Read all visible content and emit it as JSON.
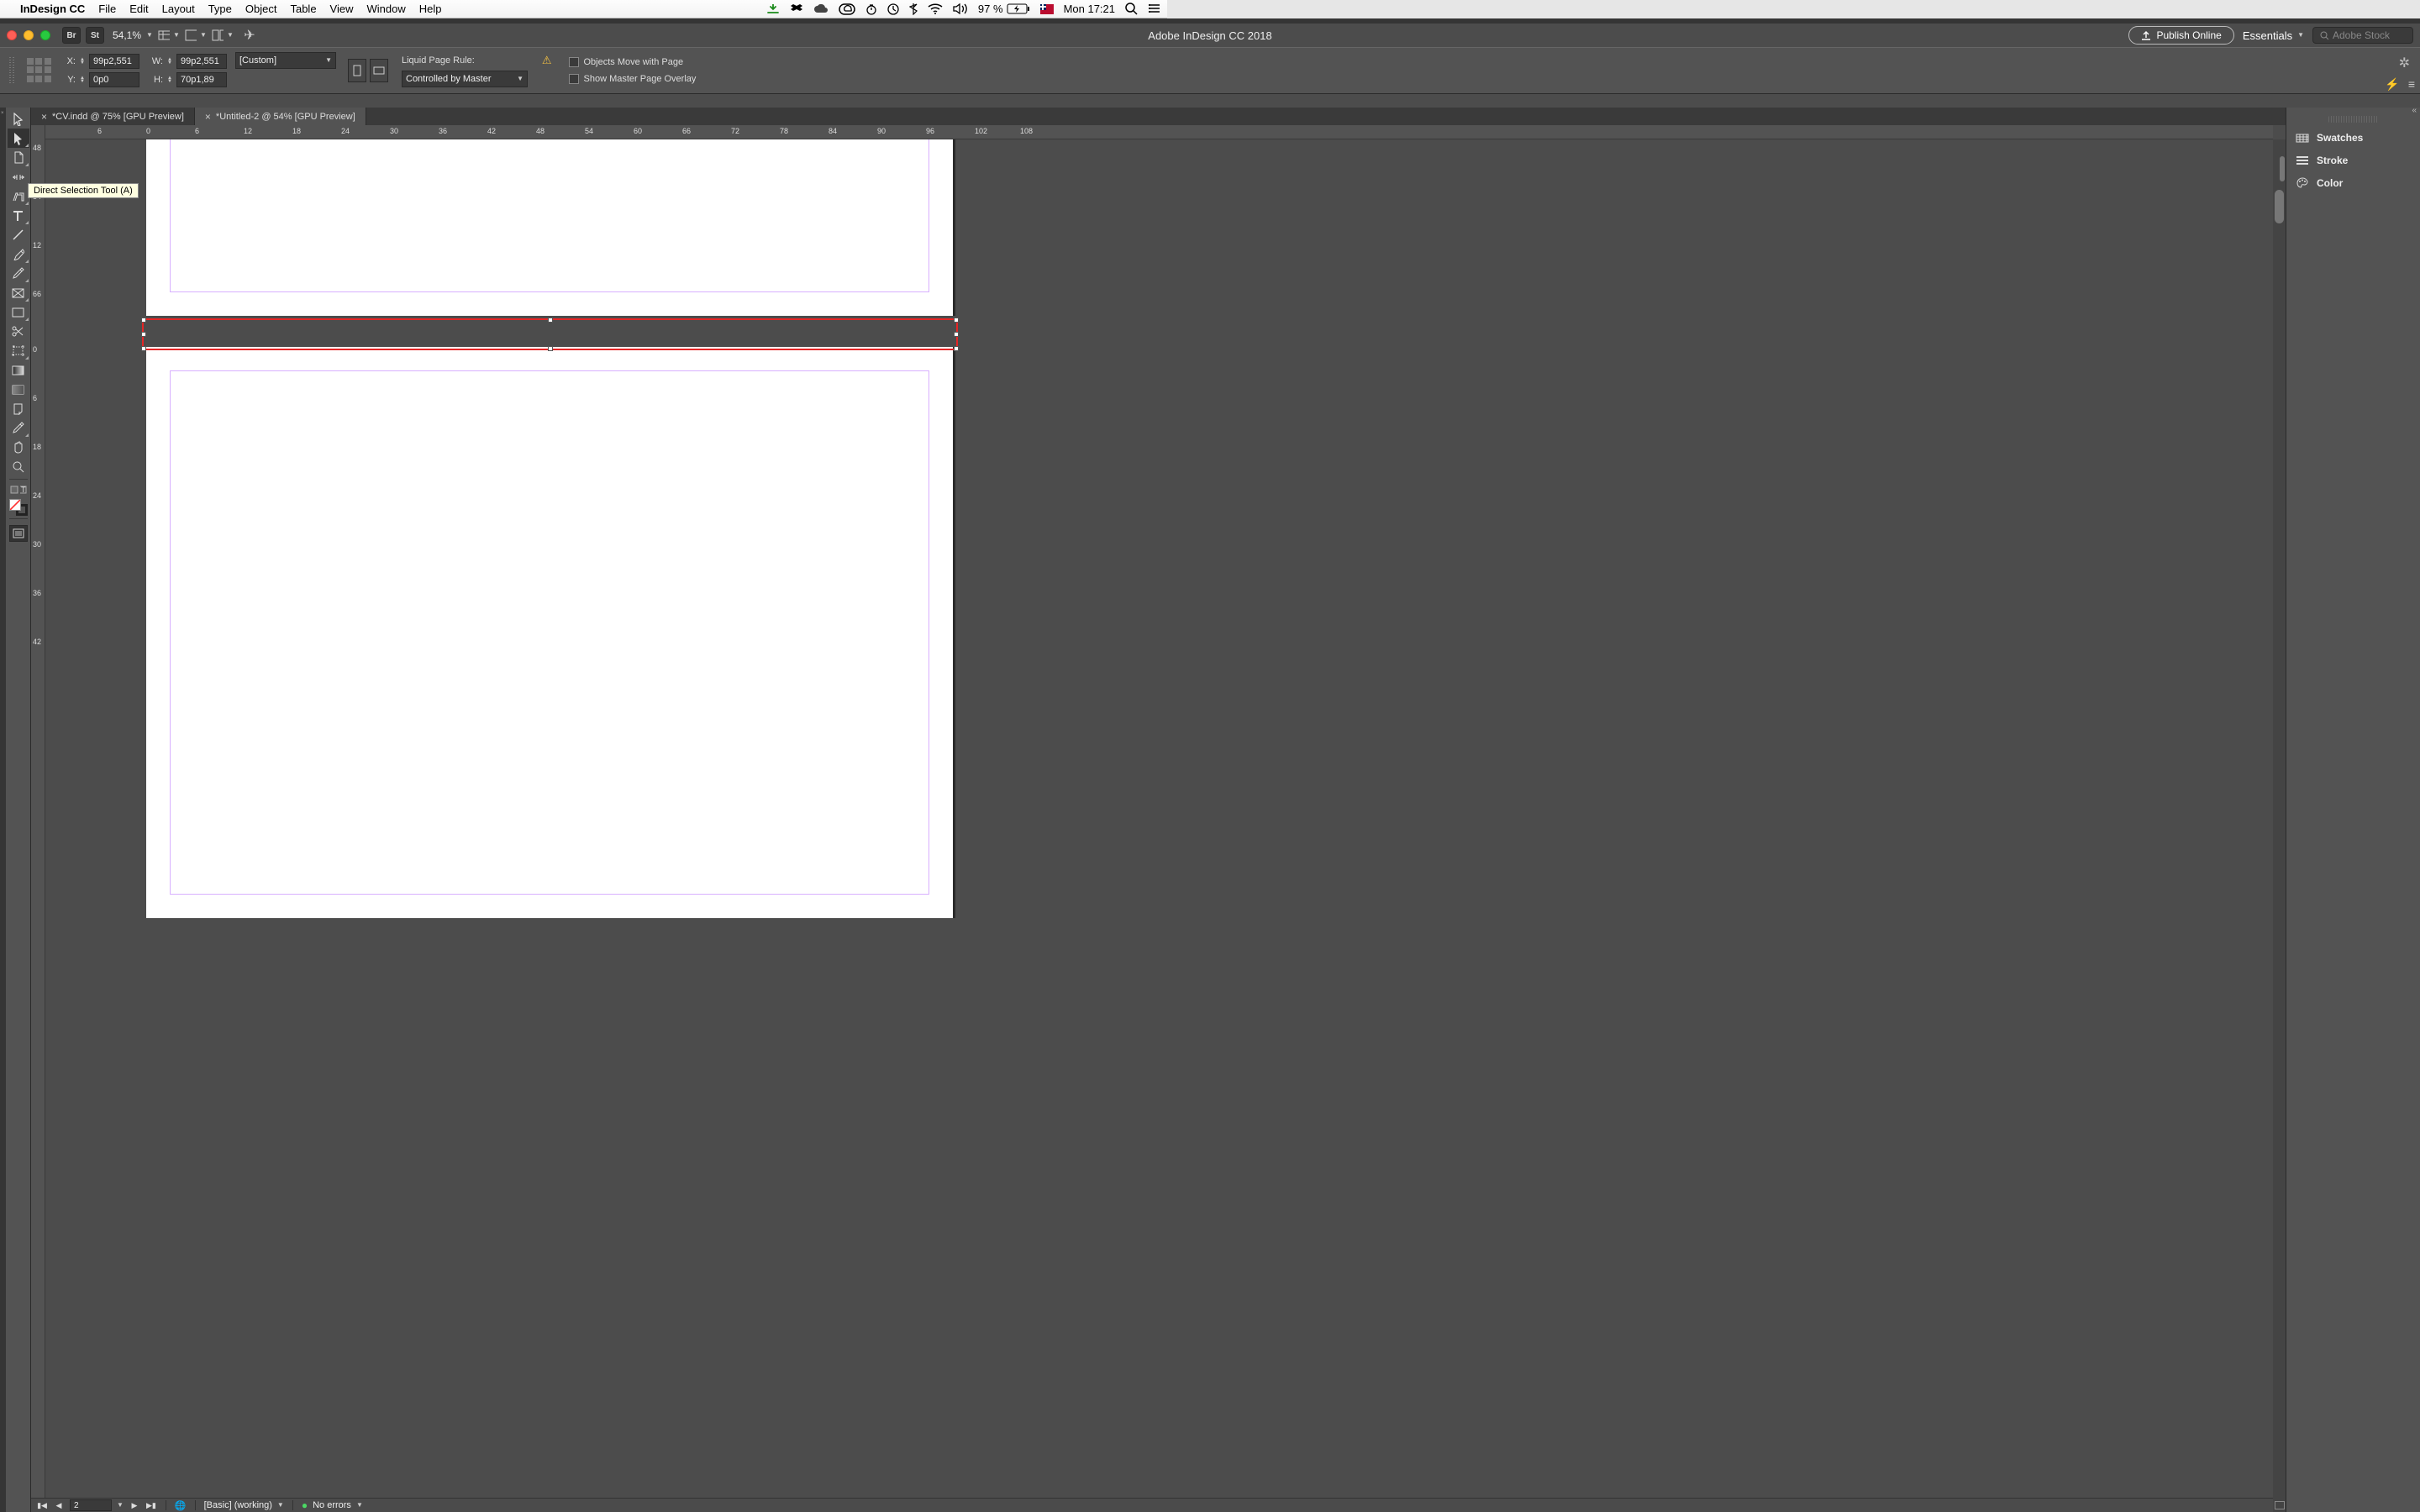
{
  "menubar": {
    "app_name": "InDesign CC",
    "items": [
      "File",
      "Edit",
      "Layout",
      "Type",
      "Object",
      "Table",
      "View",
      "Window",
      "Help"
    ],
    "battery": "97 %",
    "clock": "Mon 17:21"
  },
  "titlebar": {
    "br": "Br",
    "st": "St",
    "zoom": "54,1%",
    "title": "Adobe InDesign CC 2018",
    "publish": "Publish Online",
    "workspace": "Essentials",
    "search_placeholder": "Adobe Stock"
  },
  "controlbar": {
    "x_label": "X:",
    "y_label": "Y:",
    "w_label": "W:",
    "h_label": "H:",
    "x": "99p2,551",
    "y": "0p0",
    "w": "99p2,551",
    "h": "70p1,89",
    "preset": "[Custom]",
    "liquid_label": "Liquid Page Rule:",
    "liquid_value": "Controlled by Master",
    "cb1": "Objects Move with Page",
    "cb2": "Show Master Page Overlay"
  },
  "tooltip": "Direct Selection Tool (A)",
  "tabs": [
    {
      "label": "*CV.indd @ 75% [GPU Preview]",
      "active": false
    },
    {
      "label": "*Untitled-2 @ 54% [GPU Preview]",
      "active": true
    }
  ],
  "hruler_ticks": [
    "6",
    "0",
    "6",
    "12",
    "18",
    "24",
    "30",
    "36",
    "42",
    "48",
    "54",
    "60",
    "66",
    "72",
    "78",
    "84",
    "90",
    "96",
    "102",
    "108"
  ],
  "vruler_ticks": [
    "48",
    "54",
    "0",
    "6",
    "66",
    "12",
    "18",
    "24",
    "30",
    "36",
    "42"
  ],
  "status": {
    "page": "2",
    "preflight_profile": "[Basic] (working)",
    "errors": "No errors"
  },
  "panels": [
    "Swatches",
    "Stroke",
    "Color"
  ]
}
